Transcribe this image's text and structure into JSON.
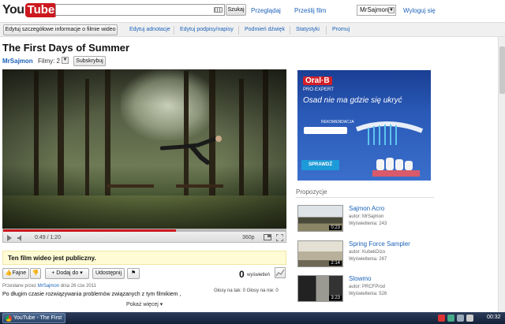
{
  "header": {
    "logo_you": "You",
    "logo_tube": "Tube",
    "search_value": "",
    "search_button": "Szukaj",
    "nav": [
      "Przeglądaj",
      "Prześlij film"
    ],
    "user": "MrSajmon",
    "logout": "Wyloguj się"
  },
  "owner_bar": {
    "details_button": "Edytuj szczegółowe informacje o filmie wideo",
    "links": [
      "Edytuj adnotacje",
      "Edytuj podpisy/napisy",
      "Podmień dźwięk",
      "Statystyki",
      "Promuj"
    ]
  },
  "video": {
    "title": "The First Days of Summer",
    "channel": "MrSajmon",
    "videos_label": "Filmy: 2",
    "subscribe": "Subskrybuj",
    "time": "0:49 / 1:20",
    "quality": "360p",
    "progress": 0.6125
  },
  "below": {
    "public_notice": "Ten film wideo jest publiczny.",
    "like": "Fajne",
    "add_to": "Dodaj do",
    "share": "Udostępnij",
    "views_count": "0",
    "views_label": "wyświetleń",
    "uploader_prefix": "Przesłane przez",
    "uploader": "MrSajmon",
    "upload_date": "dnia 26 cze 2011",
    "votes": "Głosy na tak: 0 Głosy na nie: 0",
    "description": "Po długim czasie rozwiązywania problemów związanych z tym filmikiem ,",
    "show_more": "Pokaż więcej"
  },
  "ad": {
    "brand": "Oral·B",
    "line": "PRO·EXPERT",
    "slogan": "Osad nie ma gdzie się ukryć",
    "recommend": "REKOMENDACJA",
    "cta": "SPRAWDŹ"
  },
  "suggestions": {
    "header": "Propozycje",
    "items": [
      {
        "title": "Sajmon Acro",
        "author": "autor: MrSajmon",
        "views": "Wyświetlenia: 243",
        "duration": "0:23"
      },
      {
        "title": "Spring Force Sampler",
        "author": "autor: KubekDizo",
        "views": "Wyświetlenia: 267",
        "duration": "2:14"
      },
      {
        "title": "Slowmo",
        "author": "autor: PRCFProd",
        "views": "Wyświetlenia: 526",
        "duration": "3:23"
      }
    ]
  },
  "taskbar": {
    "window": "YouTube - The First ...",
    "clock": "00:32"
  }
}
